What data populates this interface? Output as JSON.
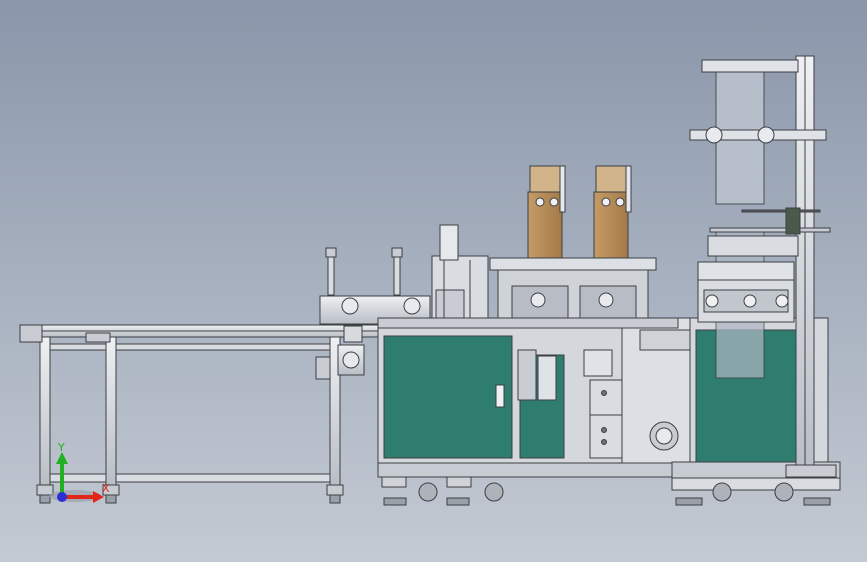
{
  "window": {
    "background_top": "#8a97aa",
    "background_bottom": "#c4cad3"
  },
  "colors": {
    "cabinet_panel": "#2e7d6f",
    "frame_steel": "#d5d9de",
    "frame_line": "#3c3f44",
    "wood_panel": "#b48a58",
    "film_roll": "#bcc4cf"
  },
  "triad": {
    "x_label": "X",
    "y_label": "Y",
    "x_color": "#e3261b",
    "y_color": "#20b020",
    "z_color": "#2a2fd6"
  },
  "icons": [
    "coordinate-triad-icon"
  ]
}
